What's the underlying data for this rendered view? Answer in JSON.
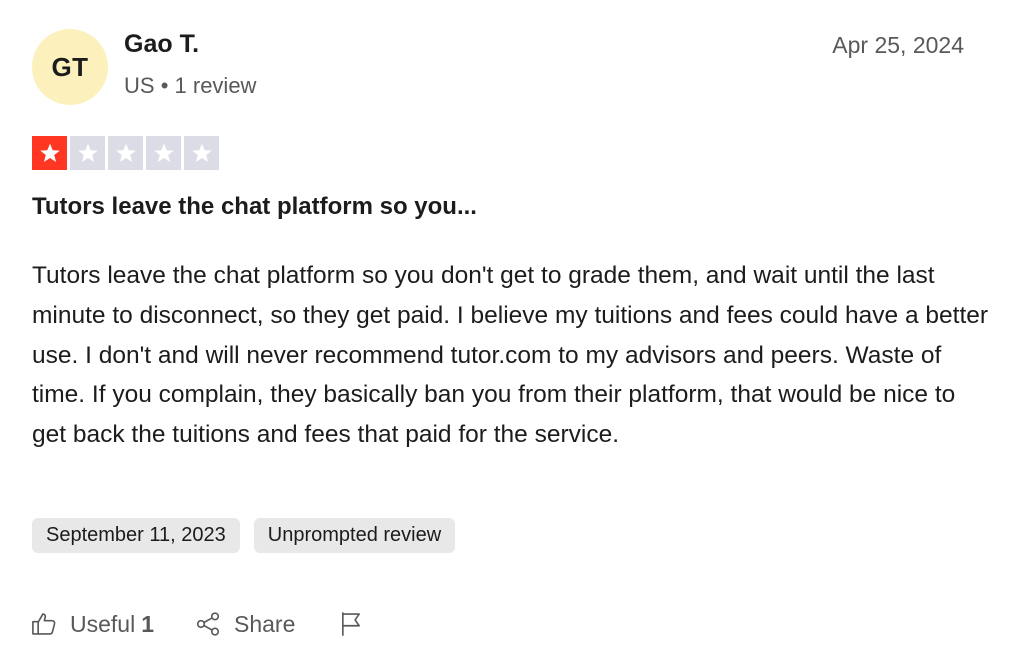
{
  "reviewer": {
    "initials": "GT",
    "name": "Gao T.",
    "country": "US",
    "separator": "•",
    "review_count": "1 review"
  },
  "review": {
    "date": "Apr 25, 2024",
    "rating": 1,
    "max_rating": 5,
    "title": "Tutors leave the chat platform so you...",
    "body": "Tutors leave the chat platform so you don't get to grade them, and wait until the last minute to disconnect, so they get paid. I believe my tuitions and fees could have a better use. I don't and will never recommend tutor.com to my advisors and peers. Waste of time. If you complain, they basically ban you from their platform, that would be nice to get back the tuitions and fees that paid for the service.",
    "tags": [
      {
        "label": "September 11, 2023"
      },
      {
        "label": "Unprompted review"
      }
    ]
  },
  "actions": {
    "useful_label": "Useful",
    "useful_count": "1",
    "share_label": "Share",
    "useful_icon": "thumbs-up-icon",
    "share_icon": "share-icon",
    "flag_icon": "flag-icon"
  },
  "colors": {
    "star_filled": "#ff3722",
    "star_empty": "#dcdce6",
    "avatar_bg": "#fcf1bd",
    "tag_bg": "#e8e8e8",
    "muted_text": "#595959",
    "primary_text": "#1c1c1c"
  }
}
